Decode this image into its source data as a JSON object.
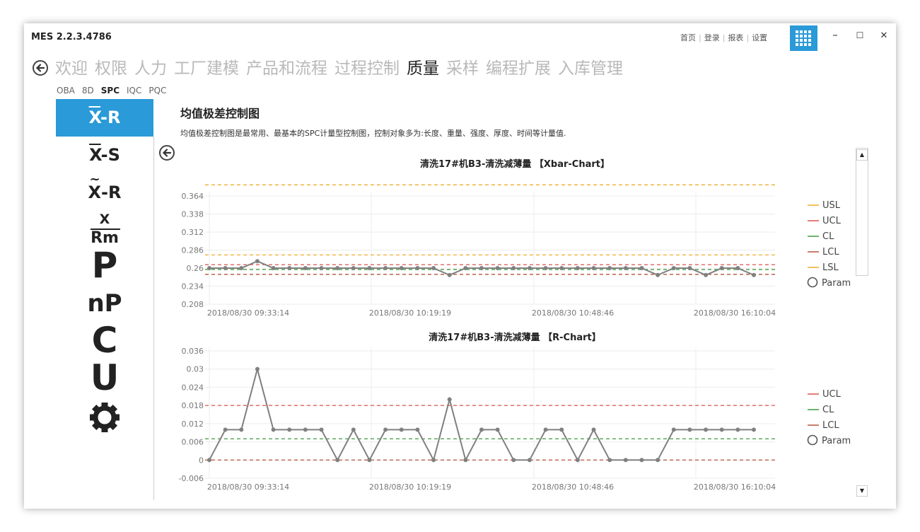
{
  "app": {
    "title": "MES 2.2.3.4786"
  },
  "toplinks": [
    "首页",
    "登录",
    "报表",
    "设置"
  ],
  "icons": {
    "apps": "grid-icon",
    "minimize": "minimize-icon",
    "maximize": "maximize-icon",
    "close": "close-icon",
    "back": "arrow-left-circle-icon",
    "settings": "gear-icon",
    "scroll_up": "triangle-up-icon",
    "scroll_down": "triangle-down-icon"
  },
  "window_controls": {
    "minimize": "–",
    "maximize": "☐",
    "close": "✕"
  },
  "colors": {
    "accent": "#2a9ad8",
    "usl": "#f0ad2e",
    "ucl": "#d9534f",
    "cl": "#3e9a3e",
    "lcl": "#b8533a",
    "lsl": "#f0ad2e",
    "param": "#808080"
  },
  "modules": [
    {
      "label": "欢迎",
      "active": false
    },
    {
      "label": "权限",
      "active": false
    },
    {
      "label": "人力",
      "active": false
    },
    {
      "label": "工厂建模",
      "active": false
    },
    {
      "label": "产品和流程",
      "active": false
    },
    {
      "label": "过程控制",
      "active": false
    },
    {
      "label": "质量",
      "active": true
    },
    {
      "label": "采样",
      "active": false
    },
    {
      "label": "编程扩展",
      "active": false
    },
    {
      "label": "入库管理",
      "active": false
    }
  ],
  "submodules": [
    {
      "label": "OBA",
      "active": false
    },
    {
      "label": "8D",
      "active": false
    },
    {
      "label": "SPC",
      "active": true
    },
    {
      "label": "IQC",
      "active": false
    },
    {
      "label": "PQC",
      "active": false
    }
  ],
  "sidebar": [
    {
      "top": "X",
      "bottom": "-R",
      "style": "bar",
      "active": true
    },
    {
      "top": "X",
      "bottom": "-S",
      "style": "bar",
      "active": false
    },
    {
      "top": "X",
      "bottom": "-R",
      "style": "tilde",
      "active": false
    },
    {
      "top": "X",
      "bottom": "Rm",
      "style": "fraction",
      "active": false
    },
    {
      "label": "P",
      "size": "big",
      "active": false
    },
    {
      "label": "nP",
      "size": "mid",
      "active": false
    },
    {
      "label": "C",
      "size": "big",
      "active": false
    },
    {
      "label": "U",
      "size": "big",
      "active": false
    },
    {
      "icon": "gear-icon",
      "active": false
    }
  ],
  "content": {
    "title": "均值极差控制图",
    "description": "均值极差控制图是最常用、最基本的SPC计量型控制图，控制对象多为:长度、重量、强度、厚度、时间等计量值."
  },
  "chart_data": [
    {
      "type": "line",
      "title": "清洗17#机B3-清洗减薄量 【Xbar-Chart】",
      "x_tick_labels": [
        "2018/08/30 09:33:14",
        "2018/08/30 10:19:19",
        "2018/08/30 10:48:46",
        "2018/08/30 16:10:04"
      ],
      "y_ticks": [
        0.208,
        0.234,
        0.26,
        0.286,
        0.312,
        0.338,
        0.364
      ],
      "ylim": [
        0.208,
        0.364
      ],
      "grid": true,
      "legend_position": "right",
      "control_lines": [
        {
          "name": "USL",
          "value": 0.38,
          "color": "#f0ad2e"
        },
        {
          "name": "UCL",
          "value": 0.265,
          "color": "#d9534f"
        },
        {
          "name": "CL",
          "value": 0.258,
          "color": "#3e9a3e"
        },
        {
          "name": "LCL",
          "value": 0.251,
          "color": "#b8533a"
        },
        {
          "name": "LSL",
          "value": 0.279,
          "color": "#f0ad2e"
        }
      ],
      "series": [
        {
          "name": "Param",
          "color": "#808080",
          "values": [
            0.26,
            0.26,
            0.26,
            0.27,
            0.26,
            0.26,
            0.26,
            0.26,
            0.26,
            0.26,
            0.26,
            0.26,
            0.26,
            0.26,
            0.26,
            0.25,
            0.26,
            0.26,
            0.26,
            0.26,
            0.26,
            0.26,
            0.26,
            0.26,
            0.26,
            0.26,
            0.26,
            0.26,
            0.25,
            0.26,
            0.26,
            0.25,
            0.26,
            0.26,
            0.25
          ]
        }
      ]
    },
    {
      "type": "line",
      "title": "清洗17#机B3-清洗减薄量 【R-Chart】",
      "x_tick_labels": [
        "2018/08/30 09:33:14",
        "2018/08/30 10:19:19",
        "2018/08/30 10:48:46",
        "2018/08/30 16:10:04"
      ],
      "y_ticks": [
        -0.006,
        0,
        0.006,
        0.012,
        0.018,
        0.024,
        0.03,
        0.036
      ],
      "ylim": [
        -0.006,
        0.036
      ],
      "grid": true,
      "legend_position": "right",
      "control_lines": [
        {
          "name": "UCL",
          "value": 0.018,
          "color": "#d9534f"
        },
        {
          "name": "CL",
          "value": 0.007,
          "color": "#3e9a3e"
        },
        {
          "name": "LCL",
          "value": 0,
          "color": "#b8533a"
        }
      ],
      "series": [
        {
          "name": "Param",
          "color": "#808080",
          "values": [
            0,
            0.01,
            0.01,
            0.03,
            0.01,
            0.01,
            0.01,
            0.01,
            0,
            0.01,
            0,
            0.01,
            0.01,
            0.01,
            0,
            0.02,
            0,
            0.01,
            0.01,
            0,
            0,
            0.01,
            0.01,
            0,
            0.01,
            0,
            0,
            0,
            0,
            0.01,
            0.01,
            0.01,
            0.01,
            0.01,
            0.01
          ]
        }
      ]
    }
  ]
}
